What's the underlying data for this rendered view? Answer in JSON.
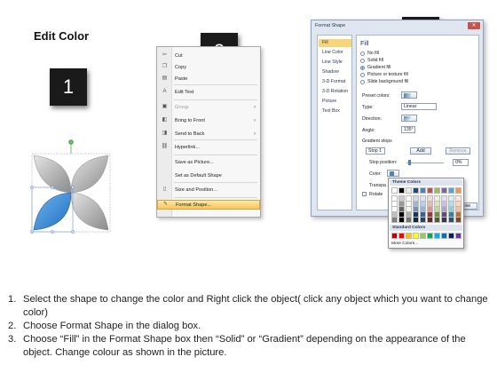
{
  "title": "Edit Color",
  "steps_badges": [
    "1",
    "2",
    "3"
  ],
  "context_menu": {
    "items": [
      {
        "label": "Cut",
        "icon": "scissors-icon",
        "glyph": "✂",
        "disabled": false,
        "submenu": false
      },
      {
        "label": "Copy",
        "icon": "copy-icon",
        "glyph": "❐",
        "disabled": false,
        "submenu": false
      },
      {
        "label": "Paste",
        "icon": "paste-icon",
        "glyph": "▤",
        "disabled": false,
        "submenu": false
      },
      {
        "label": "Edit Text",
        "icon": "edit-text-icon",
        "glyph": "A",
        "disabled": false,
        "submenu": false
      },
      {
        "label": "Group",
        "icon": "group-icon",
        "glyph": "▣",
        "disabled": true,
        "submenu": true
      },
      {
        "label": "Bring to Front",
        "icon": "bring-front-icon",
        "glyph": "◧",
        "disabled": false,
        "submenu": true
      },
      {
        "label": "Send to Back",
        "icon": "send-back-icon",
        "glyph": "◨",
        "disabled": false,
        "submenu": true
      },
      {
        "label": "Hyperlink...",
        "icon": "hyperlink-icon",
        "glyph": "⛓",
        "disabled": false,
        "submenu": false
      },
      {
        "label": "Save as Picture...",
        "icon": "",
        "glyph": "",
        "disabled": false,
        "submenu": false
      },
      {
        "label": "Set as Default Shape",
        "icon": "",
        "glyph": "",
        "disabled": false,
        "submenu": false
      },
      {
        "label": "Size and Position...",
        "icon": "size-icon",
        "glyph": "▯",
        "disabled": false,
        "submenu": false
      },
      {
        "label": "Format Shape...",
        "icon": "format-shape-icon",
        "glyph": "✎",
        "disabled": false,
        "submenu": false,
        "highlighted": true
      }
    ]
  },
  "dialog": {
    "title": "Format Shape",
    "close_glyph": "✕",
    "categories": [
      "Fill",
      "Line Color",
      "Line Style",
      "Shadow",
      "3-D Format",
      "3-D Rotation",
      "Picture",
      "Text Box"
    ],
    "selected_category": "Fill",
    "heading": "Fill",
    "fill_options": [
      "No fill",
      "Solid fill",
      "Gradient fill",
      "Picture or texture fill",
      "Slide background fill"
    ],
    "selected_fill": "Gradient fill",
    "preset_colors_label": "Preset colors:",
    "type_label": "Type:",
    "type_value": "Linear",
    "direction_label": "Direction:",
    "angle_label": "Angle:",
    "angle_value": "135°",
    "gradient_stops_label": "Gradient stops",
    "stop_value": "Stop 1",
    "add_label": "Add",
    "remove_label": "Remove",
    "stop_position_label": "Stop position:",
    "stop_position_value": "0%",
    "color_label": "Color:",
    "transparency_label": "Transpa",
    "rotate_label": "Rotate",
    "close_button_label": "ose"
  },
  "color_popup": {
    "theme_header": "Theme Colors",
    "standard_header": "Standard Colors",
    "more_label": "More Colors...",
    "theme_row": [
      "#ffffff",
      "#000000",
      "#eeece1",
      "#1f497d",
      "#4f81bd",
      "#c0504d",
      "#9bbb59",
      "#8064a2",
      "#4bacc6",
      "#f79646"
    ],
    "standard_row": [
      "#c00000",
      "#ff0000",
      "#ffc000",
      "#ffff00",
      "#92d050",
      "#00b050",
      "#00b0f0",
      "#0070c0",
      "#002060",
      "#7030a0"
    ]
  },
  "instructions": [
    {
      "num": "1.",
      "text": "Select the shape to change the color and Right click the object( click any object which you want to change color)"
    },
    {
      "num": "2.",
      "text": "Choose Format Shape in the dialog box."
    },
    {
      "num": "3.",
      "text": "Choose “Fill” in the Format Shape box then “Solid” or “Gradient” depending on the appearance of the object. Change colour as shown in the picture."
    }
  ]
}
